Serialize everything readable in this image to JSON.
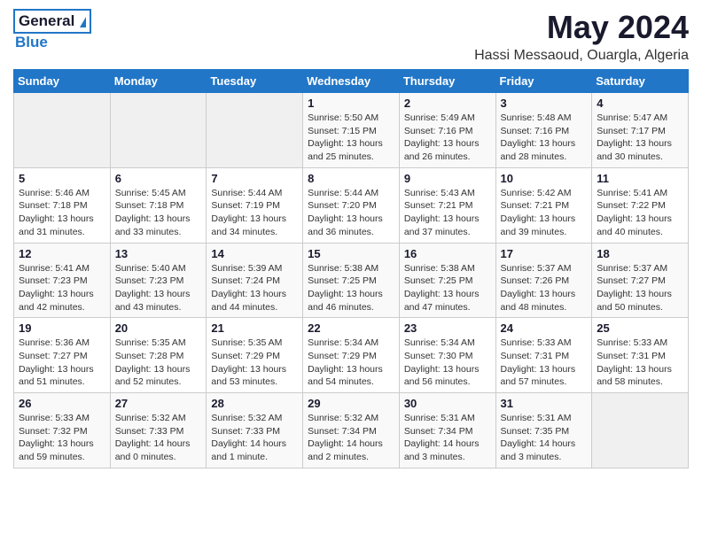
{
  "header": {
    "logo_general": "General",
    "logo_blue": "Blue",
    "title": "May 2024",
    "subtitle": "Hassi Messaoud, Ouargla, Algeria"
  },
  "calendar": {
    "days_of_week": [
      "Sunday",
      "Monday",
      "Tuesday",
      "Wednesday",
      "Thursday",
      "Friday",
      "Saturday"
    ],
    "weeks": [
      {
        "days": [
          {
            "number": "",
            "info": ""
          },
          {
            "number": "",
            "info": ""
          },
          {
            "number": "",
            "info": ""
          },
          {
            "number": "1",
            "info": "Sunrise: 5:50 AM\nSunset: 7:15 PM\nDaylight: 13 hours and 25 minutes."
          },
          {
            "number": "2",
            "info": "Sunrise: 5:49 AM\nSunset: 7:16 PM\nDaylight: 13 hours and 26 minutes."
          },
          {
            "number": "3",
            "info": "Sunrise: 5:48 AM\nSunset: 7:16 PM\nDaylight: 13 hours and 28 minutes."
          },
          {
            "number": "4",
            "info": "Sunrise: 5:47 AM\nSunset: 7:17 PM\nDaylight: 13 hours and 30 minutes."
          }
        ]
      },
      {
        "days": [
          {
            "number": "5",
            "info": "Sunrise: 5:46 AM\nSunset: 7:18 PM\nDaylight: 13 hours and 31 minutes."
          },
          {
            "number": "6",
            "info": "Sunrise: 5:45 AM\nSunset: 7:18 PM\nDaylight: 13 hours and 33 minutes."
          },
          {
            "number": "7",
            "info": "Sunrise: 5:44 AM\nSunset: 7:19 PM\nDaylight: 13 hours and 34 minutes."
          },
          {
            "number": "8",
            "info": "Sunrise: 5:44 AM\nSunset: 7:20 PM\nDaylight: 13 hours and 36 minutes."
          },
          {
            "number": "9",
            "info": "Sunrise: 5:43 AM\nSunset: 7:21 PM\nDaylight: 13 hours and 37 minutes."
          },
          {
            "number": "10",
            "info": "Sunrise: 5:42 AM\nSunset: 7:21 PM\nDaylight: 13 hours and 39 minutes."
          },
          {
            "number": "11",
            "info": "Sunrise: 5:41 AM\nSunset: 7:22 PM\nDaylight: 13 hours and 40 minutes."
          }
        ]
      },
      {
        "days": [
          {
            "number": "12",
            "info": "Sunrise: 5:41 AM\nSunset: 7:23 PM\nDaylight: 13 hours and 42 minutes."
          },
          {
            "number": "13",
            "info": "Sunrise: 5:40 AM\nSunset: 7:23 PM\nDaylight: 13 hours and 43 minutes."
          },
          {
            "number": "14",
            "info": "Sunrise: 5:39 AM\nSunset: 7:24 PM\nDaylight: 13 hours and 44 minutes."
          },
          {
            "number": "15",
            "info": "Sunrise: 5:38 AM\nSunset: 7:25 PM\nDaylight: 13 hours and 46 minutes."
          },
          {
            "number": "16",
            "info": "Sunrise: 5:38 AM\nSunset: 7:25 PM\nDaylight: 13 hours and 47 minutes."
          },
          {
            "number": "17",
            "info": "Sunrise: 5:37 AM\nSunset: 7:26 PM\nDaylight: 13 hours and 48 minutes."
          },
          {
            "number": "18",
            "info": "Sunrise: 5:37 AM\nSunset: 7:27 PM\nDaylight: 13 hours and 50 minutes."
          }
        ]
      },
      {
        "days": [
          {
            "number": "19",
            "info": "Sunrise: 5:36 AM\nSunset: 7:27 PM\nDaylight: 13 hours and 51 minutes."
          },
          {
            "number": "20",
            "info": "Sunrise: 5:35 AM\nSunset: 7:28 PM\nDaylight: 13 hours and 52 minutes."
          },
          {
            "number": "21",
            "info": "Sunrise: 5:35 AM\nSunset: 7:29 PM\nDaylight: 13 hours and 53 minutes."
          },
          {
            "number": "22",
            "info": "Sunrise: 5:34 AM\nSunset: 7:29 PM\nDaylight: 13 hours and 54 minutes."
          },
          {
            "number": "23",
            "info": "Sunrise: 5:34 AM\nSunset: 7:30 PM\nDaylight: 13 hours and 56 minutes."
          },
          {
            "number": "24",
            "info": "Sunrise: 5:33 AM\nSunset: 7:31 PM\nDaylight: 13 hours and 57 minutes."
          },
          {
            "number": "25",
            "info": "Sunrise: 5:33 AM\nSunset: 7:31 PM\nDaylight: 13 hours and 58 minutes."
          }
        ]
      },
      {
        "days": [
          {
            "number": "26",
            "info": "Sunrise: 5:33 AM\nSunset: 7:32 PM\nDaylight: 13 hours and 59 minutes."
          },
          {
            "number": "27",
            "info": "Sunrise: 5:32 AM\nSunset: 7:33 PM\nDaylight: 14 hours and 0 minutes."
          },
          {
            "number": "28",
            "info": "Sunrise: 5:32 AM\nSunset: 7:33 PM\nDaylight: 14 hours and 1 minute."
          },
          {
            "number": "29",
            "info": "Sunrise: 5:32 AM\nSunset: 7:34 PM\nDaylight: 14 hours and 2 minutes."
          },
          {
            "number": "30",
            "info": "Sunrise: 5:31 AM\nSunset: 7:34 PM\nDaylight: 14 hours and 3 minutes."
          },
          {
            "number": "31",
            "info": "Sunrise: 5:31 AM\nSunset: 7:35 PM\nDaylight: 14 hours and 3 minutes."
          },
          {
            "number": "",
            "info": ""
          }
        ]
      }
    ]
  }
}
